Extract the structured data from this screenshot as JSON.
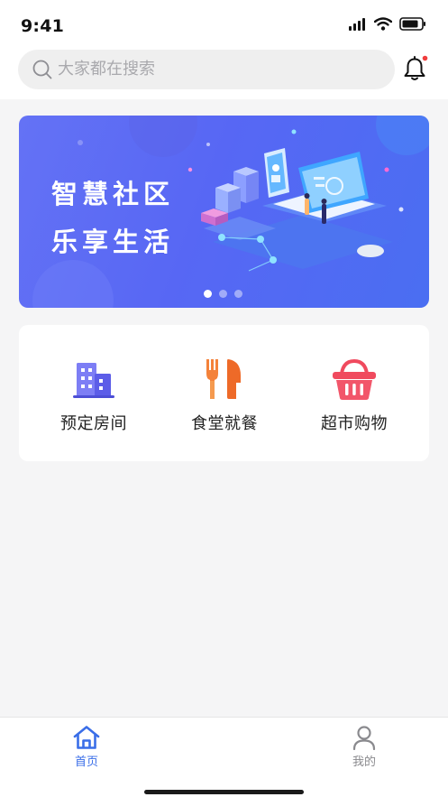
{
  "status_bar": {
    "time": "9:41"
  },
  "search": {
    "placeholder": "大家都在搜索"
  },
  "banner": {
    "line1": "智慧社区",
    "line2": "乐享生活",
    "slide_count": 3,
    "active_slide": 1
  },
  "services": [
    {
      "label": "预定房间",
      "icon": "building-icon",
      "color": "#6d6ef0"
    },
    {
      "label": "食堂就餐",
      "icon": "fork-knife-icon",
      "color": "#f47b2f"
    },
    {
      "label": "超市购物",
      "icon": "shopping-basket-icon",
      "color": "#f2465a"
    }
  ],
  "tabbar": {
    "items": [
      {
        "label": "首页",
        "icon": "home-icon",
        "active": true
      },
      {
        "label": "我的",
        "icon": "person-icon",
        "active": false
      }
    ],
    "active_color": "#3a6ee8"
  },
  "notification": {
    "has_unread": true,
    "dot_color": "#f03e3e"
  }
}
